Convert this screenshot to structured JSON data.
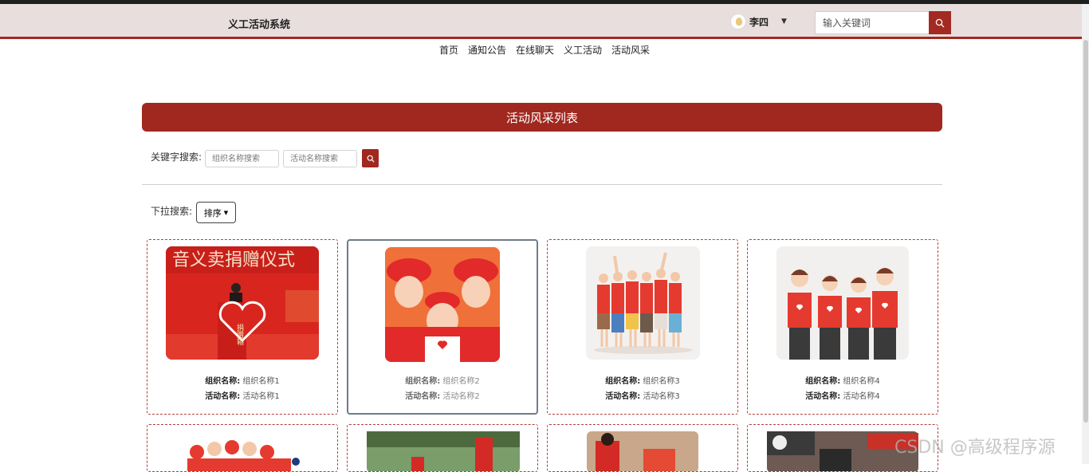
{
  "header": {
    "site_title": "义工活动系统",
    "user_name": "李四",
    "search_placeholder": "输入关键词"
  },
  "nav": [
    "首页",
    "通知公告",
    "在线聊天",
    "义工活动",
    "活动风采"
  ],
  "banner_title": "活动风采列表",
  "keyword_search": {
    "label": "关键字搜索:",
    "org_placeholder": "组织名称搜索",
    "activity_placeholder": "活动名称搜索"
  },
  "dropdown_search": {
    "label": "下拉搜索:",
    "sort_label": "排序"
  },
  "cards": [
    {
      "org_label": "组织名称:",
      "org": "组织名称1",
      "act_label": "活动名称:",
      "act": "活动名称1"
    },
    {
      "org_label": "组织名称:",
      "org": "组织名称2",
      "act_label": "活动名称:",
      "act": "活动名称2"
    },
    {
      "org_label": "组织名称:",
      "org": "组织名称3",
      "act_label": "活动名称:",
      "act": "活动名称3"
    },
    {
      "org_label": "组织名称:",
      "org": "组织名称4",
      "act_label": "活动名称:",
      "act": "活动名称4"
    }
  ],
  "banner_image_text": {
    "title_fragment": "音义卖捐赠仪式",
    "heart_text": "捐赠箱"
  },
  "watermark": "CSDN @高级程序源",
  "colors": {
    "brand_red": "#a1281f",
    "header_bg": "#e7dedd"
  }
}
